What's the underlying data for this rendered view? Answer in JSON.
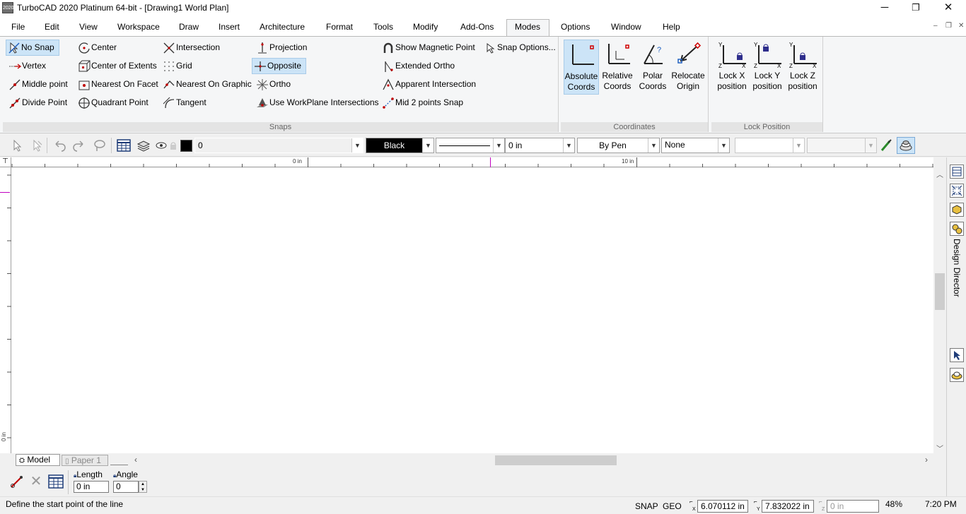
{
  "window": {
    "title": "TurboCAD 2020 Platinum 64-bit - [Drawing1 World Plan]",
    "app_icon_text": "2020",
    "minimize": "─",
    "restore": "❐",
    "close": "✕"
  },
  "menubar": {
    "items": [
      "File",
      "Edit",
      "View",
      "Workspace",
      "Draw",
      "Insert",
      "Architecture",
      "Format",
      "Tools",
      "Modify",
      "Add-Ons",
      "Modes",
      "Options",
      "Window",
      "Help"
    ],
    "active": "Modes",
    "mdi_minimize": "–",
    "mdi_restore": "❐",
    "mdi_close": "✕"
  },
  "ribbon": {
    "snaps_group_label": "Snaps",
    "coordinates_group_label": "Coordinates",
    "lock_group_label": "Lock Position",
    "snaps": {
      "no_snap": "No Snap",
      "vertex": "Vertex",
      "middle_point": "Middle point",
      "divide_point": "Divide Point",
      "center": "Center",
      "center_of_extents": "Center of Extents",
      "nearest_on_facet": "Nearest On Facet",
      "quadrant_point": "Quadrant Point",
      "intersection": "Intersection",
      "grid": "Grid",
      "nearest_on_graphic": "Nearest On Graphic",
      "tangent": "Tangent",
      "projection": "Projection",
      "opposite": "Opposite",
      "ortho": "Ortho",
      "use_workplane_intersections": "Use WorkPlane Intersections",
      "show_magnetic_point": "Show Magnetic Point",
      "extended_ortho": "Extended Ortho",
      "apparent_intersection": "Apparent Intersection",
      "mid_2_points_snap": "Mid 2 points Snap",
      "snap_options": "Snap Options..."
    },
    "coordinates": {
      "absolute": [
        "Absolute",
        "Coords"
      ],
      "relative": [
        "Relative",
        "Coords"
      ],
      "polar": [
        "Polar",
        "Coords"
      ],
      "relocate": [
        "Relocate",
        "Origin"
      ]
    },
    "lock": {
      "x": [
        "Lock X",
        "position"
      ],
      "y": [
        "Lock Y",
        "position"
      ],
      "z": [
        "Lock Z",
        "position"
      ],
      "axis_y": "Y",
      "axis_z": "Z",
      "axis_x": "X"
    }
  },
  "toolbar": {
    "layer_value": "0",
    "color_value": "Black",
    "width_value": "0 in",
    "pen_value": "By Pen",
    "fill_value": "None",
    "color_swatch": "#000000"
  },
  "ruler": {
    "mark_0": "0 in",
    "mark_10": "10 in",
    "left_mark": "0 in"
  },
  "tabs": {
    "model": "Model",
    "paper1": "Paper 1"
  },
  "right_panel": {
    "design_director": "Design Director"
  },
  "inspector": {
    "length_label": "Length",
    "angle_label": "Angle",
    "length_value": "0 in",
    "angle_value": "0"
  },
  "status": {
    "prompt": "Define the start point of the line",
    "snap": "SNAP",
    "geo": "GEO",
    "x_label": "X",
    "y_label": "Y",
    "z_label": "Z",
    "x_value": "6.070112 in",
    "y_value": "7.832022 in",
    "z_value": "0 in",
    "zoom": "48%",
    "time": "7:20 PM"
  },
  "colors": {
    "accent_selected": "#cce4f7",
    "group_label_bg": "#e4e4e4",
    "ruler_cursor": "#c000c0"
  }
}
